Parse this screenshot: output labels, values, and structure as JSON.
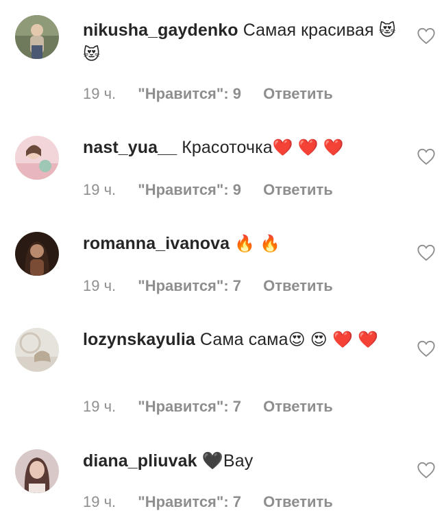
{
  "comments": [
    {
      "username": "nikusha_gaydenko",
      "text": " Самая красивая",
      "emojis": [
        "😻",
        "😻"
      ],
      "time": "19 ч.",
      "likes": "\"Нравится\": 9",
      "reply": "Ответить",
      "avatar_colors": [
        "#6f7a5c",
        "#c7b9a3"
      ]
    },
    {
      "username": "nast_yua__",
      "text": " Красоточка",
      "emojis": [
        "❤️",
        "❤️",
        "❤️"
      ],
      "time": "19 ч.",
      "likes": "\"Нравится\": 9",
      "reply": "Ответить",
      "avatar_colors": [
        "#e8b7bd",
        "#9fc7b6"
      ]
    },
    {
      "username": "romanna_ivanova",
      "text": "",
      "emojis": [
        "🔥",
        "🔥"
      ],
      "time": "19 ч.",
      "likes": "\"Нравится\": 7",
      "reply": "Ответить",
      "avatar_colors": [
        "#2a1a14",
        "#7a4c36"
      ]
    },
    {
      "username": "lozynskayulia",
      "text": " Сама сама",
      "emojis": [
        "😍",
        "😍",
        "❤️",
        "❤️"
      ],
      "time": "19 ч.",
      "likes": "\"Нравится\": 7",
      "reply": "Ответить",
      "avatar_colors": [
        "#e6e2dc",
        "#b9aa96"
      ]
    },
    {
      "username": "diana_pliuvak",
      "text": " 🖤Bay",
      "emojis": [],
      "time": "19 ч.",
      "likes": "\"Нравится\": 7",
      "reply": "Ответить",
      "avatar_colors": [
        "#d8c8c8",
        "#5a3a34"
      ]
    }
  ],
  "colors": {
    "text": "#262626",
    "meta": "#8e8e8e",
    "heart_outline": "#8e8e8e"
  },
  "icons": {
    "like": "heart-outline-icon"
  }
}
